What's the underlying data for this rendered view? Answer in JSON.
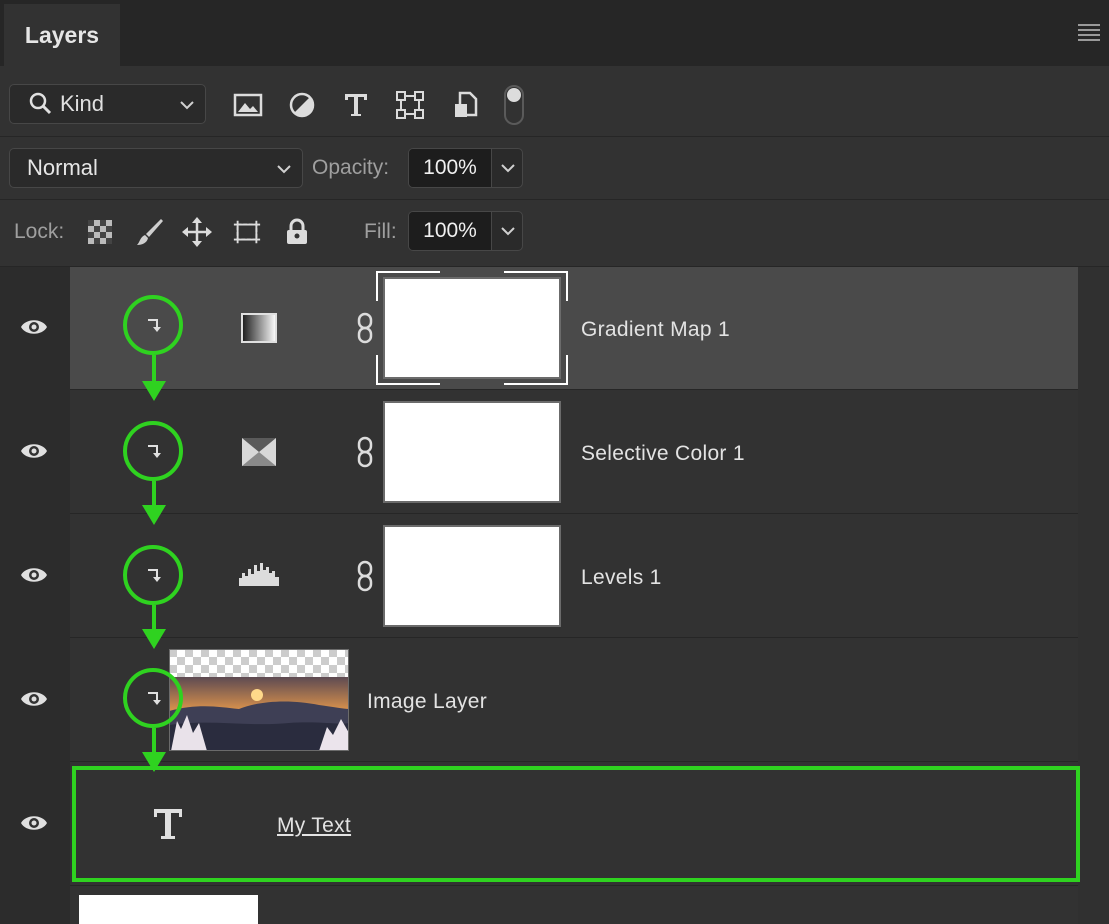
{
  "panel": {
    "tab_label": "Layers"
  },
  "filter": {
    "kind_label": "Kind"
  },
  "blend": {
    "mode": "Normal",
    "opacity_label": "Opacity:",
    "opacity_value": "100%"
  },
  "lock": {
    "label": "Lock:",
    "fill_label": "Fill:",
    "fill_value": "100%"
  },
  "layers": [
    {
      "name": "Gradient Map 1",
      "type": "adjustment",
      "adjustment_icon": "gradient-map-icon",
      "clipped": true,
      "selected": true
    },
    {
      "name": "Selective Color 1",
      "type": "adjustment",
      "adjustment_icon": "selective-color-icon",
      "clipped": true,
      "selected": false
    },
    {
      "name": "Levels 1",
      "type": "adjustment",
      "adjustment_icon": "levels-icon",
      "clipped": true,
      "selected": false
    },
    {
      "name": "Image Layer",
      "type": "image",
      "clipped": true,
      "selected": false
    },
    {
      "name": "My Text",
      "type": "text",
      "clipped": false,
      "selected": false,
      "highlighted": true
    }
  ],
  "colors": {
    "annotation_green": "#2fd220",
    "panel_bg": "#323232",
    "selected_row": "#4a4a4a"
  }
}
